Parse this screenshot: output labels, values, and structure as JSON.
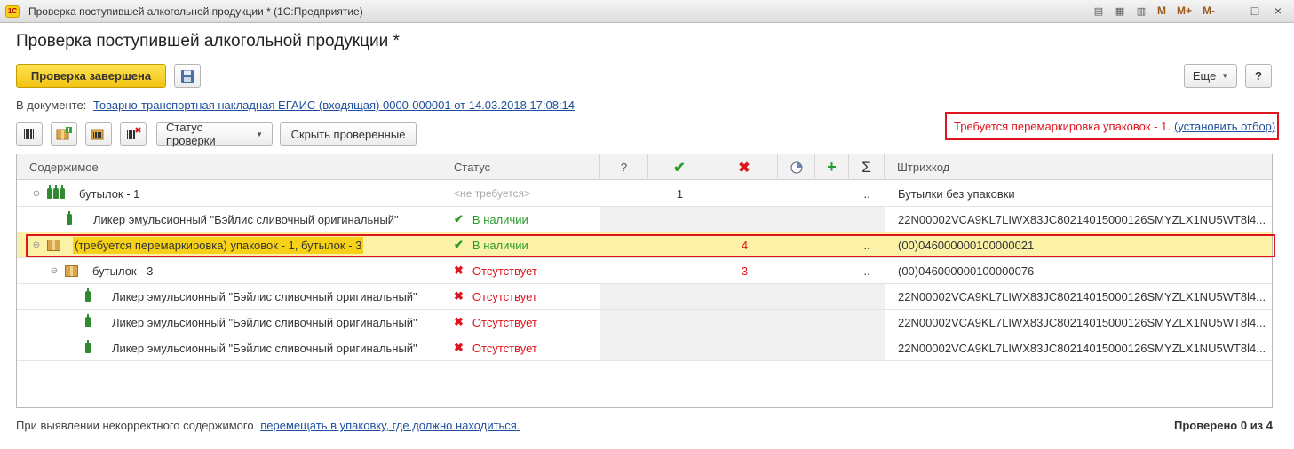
{
  "window": {
    "app_icon": "1С",
    "title": "Проверка поступившей алкогольной продукции * (1С:Предприятие)",
    "controls": [
      "M",
      "M+",
      "M-"
    ]
  },
  "page": {
    "title": "Проверка поступившей алкогольной продукции *"
  },
  "toolbar": {
    "finish_label": "Проверка завершена",
    "more_label": "Еще",
    "help_label": "?"
  },
  "document": {
    "prefix": "В документе:",
    "link": "Товарно-транспортная накладная ЕГАИС (входящая) 0000-000001 от 14.03.2018 17:08:14"
  },
  "subtoolbar": {
    "status_label": "Статус проверки",
    "hide_label": "Скрыть проверенные"
  },
  "warning": {
    "text": "Требуется перемаркировка упаковок - 1.",
    "link": "(установить отбор)"
  },
  "grid": {
    "columns": {
      "content": "Содержимое",
      "status": "Статус",
      "question": "?",
      "sigma": "Σ",
      "barcode": "Штрихкод"
    },
    "rows": [
      {
        "label": "бутылок -  1",
        "status": "<не требуется>",
        "check": "1",
        "cross": "",
        "dots": "..",
        "barcode": "Бутылки без упаковки"
      },
      {
        "label": "Ликер эмульсионный \"Бэйлис сливочный оригинальный\"",
        "status": "В наличии",
        "check": "",
        "cross": "",
        "dots": "",
        "barcode": "22N00002VCA9KL7LIWX83JC80214015000126SMYZLX1NU5WT8l4..."
      },
      {
        "label": "(требуется перемаркировка) упаковок - 1, бутылок -  3",
        "status": "В наличии",
        "check": "",
        "cross": "4",
        "dots": "..",
        "barcode": "(00)046000000100000021"
      },
      {
        "label": "бутылок -  3",
        "status": "Отсутствует",
        "check": "",
        "cross": "3",
        "dots": "..",
        "barcode": "(00)046000000100000076"
      },
      {
        "label": "Ликер эмульсионный \"Бэйлис сливочный оригинальный\"",
        "status": "Отсутствует",
        "check": "",
        "cross": "",
        "dots": "",
        "barcode": "22N00002VCA9KL7LIWX83JC80214015000126SMYZLX1NU5WT8l4..."
      },
      {
        "label": "Ликер эмульсионный \"Бэйлис сливочный оригинальный\"",
        "status": "Отсутствует",
        "check": "",
        "cross": "",
        "dots": "",
        "barcode": "22N00002VCA9KL7LIWX83JC80214015000126SMYZLX1NU5WT8l4..."
      },
      {
        "label": "Ликер эмульсионный \"Бэйлис сливочный оригинальный\"",
        "status": "Отсутствует",
        "check": "",
        "cross": "",
        "dots": "",
        "barcode": "22N00002VCA9KL7LIWX83JC80214015000126SMYZLX1NU5WT8l4..."
      }
    ]
  },
  "footer": {
    "text": "При выявлении некорректного содержимого",
    "link": "перемещать в упаковку, где должно находиться.",
    "summary": "Проверено 0 из 4"
  },
  "colors": {
    "accent_yellow": "#f7d117",
    "warning_red": "#e0141e",
    "link_blue": "#1e4f9e",
    "ok_green": "#2a9a2a"
  }
}
